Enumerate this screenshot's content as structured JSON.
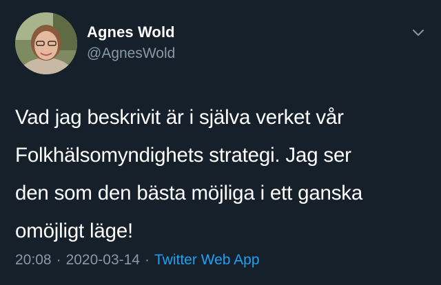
{
  "author": {
    "name": "Agnes Wold",
    "handle": "@AgnesWold",
    "avatar_icon": "profile-photo"
  },
  "menu_icon": "chevron-down-icon",
  "tweet": {
    "lines": [
      "Vad jag beskrivit är i själva verket vår",
      "Folkhälsomyndighets strategi. Jag ser",
      "den som den bästa möjliga i ett ganska",
      "omöjligt läge!"
    ]
  },
  "meta": {
    "time": "20:08",
    "separator": "·",
    "date": "2020-03-14",
    "source": "Twitter Web App"
  },
  "colors": {
    "background": "#15202b",
    "text": "#ffffff",
    "secondary": "#8899a6",
    "link": "#1da1f2"
  }
}
